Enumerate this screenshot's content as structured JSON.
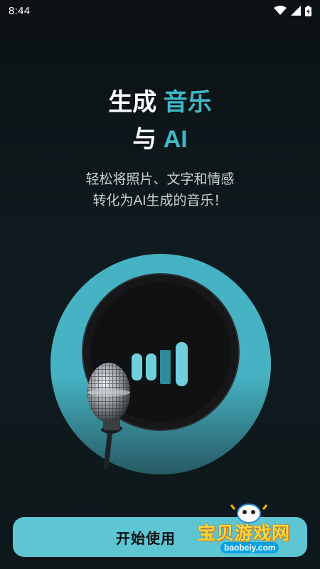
{
  "status_bar": {
    "time": "8:44"
  },
  "headline": {
    "line1_plain": "生成 ",
    "line1_accent": "音乐",
    "line2_plain": "与 ",
    "line2_accent": "AI"
  },
  "subtitle": {
    "line1": "轻松将照片、文字和情感",
    "line2": "转化为AI生成的音乐！"
  },
  "cta": {
    "label": "开始使用"
  },
  "watermark": {
    "text": "宝贝游戏网",
    "url": "baobeiy.com"
  },
  "colors": {
    "accent": "#3fb8c7",
    "button": "#5ec6d3",
    "background": "#0b1114"
  },
  "icons": [
    "wifi-icon",
    "signal-icon",
    "battery-icon",
    "sound-bars-icon",
    "microphone-icon"
  ]
}
